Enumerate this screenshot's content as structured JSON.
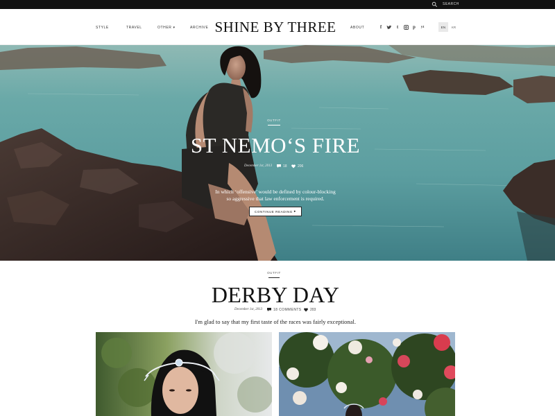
{
  "topbar": {
    "search_label": "SEARCH",
    "search_icon": "search-icon"
  },
  "header": {
    "logo": "SHINE BY THREE",
    "nav": {
      "style": "STYLE",
      "travel": "TRAVEL",
      "other": "OTHER",
      "archive": "ARCHIVE",
      "about": "ABOUT"
    },
    "social": {
      "facebook": "f",
      "twitter": "t",
      "tumblr": "t",
      "instagram_icon": "instagram-icon",
      "pinterest": "p",
      "youtube": "yt"
    },
    "languages": [
      "EN",
      "KR"
    ]
  },
  "hero": {
    "category": "OUTFIT",
    "title": "ST NEMO‘S FIRE",
    "date": "December 1st, 2013",
    "comments": "18",
    "likes": "206",
    "excerpt_line1": "In which ‘offensive’ would be defined by colour-blocking",
    "excerpt_line2": "so aggressive that law enforcement is required.",
    "button_label": "CONTINUE READING"
  },
  "article2": {
    "category": "OUTFIT",
    "title": "DERBY DAY",
    "date": "December 1st, 2013",
    "comments": "18 COMMENTS",
    "likes": "203",
    "excerpt": "I'm glad to say that my first taste of the races was fairly exceptional."
  },
  "colors": {
    "topbar": "#111111",
    "water": "#5f9fa0",
    "rock": "#3a2a26",
    "roses": "#d94a5a"
  }
}
